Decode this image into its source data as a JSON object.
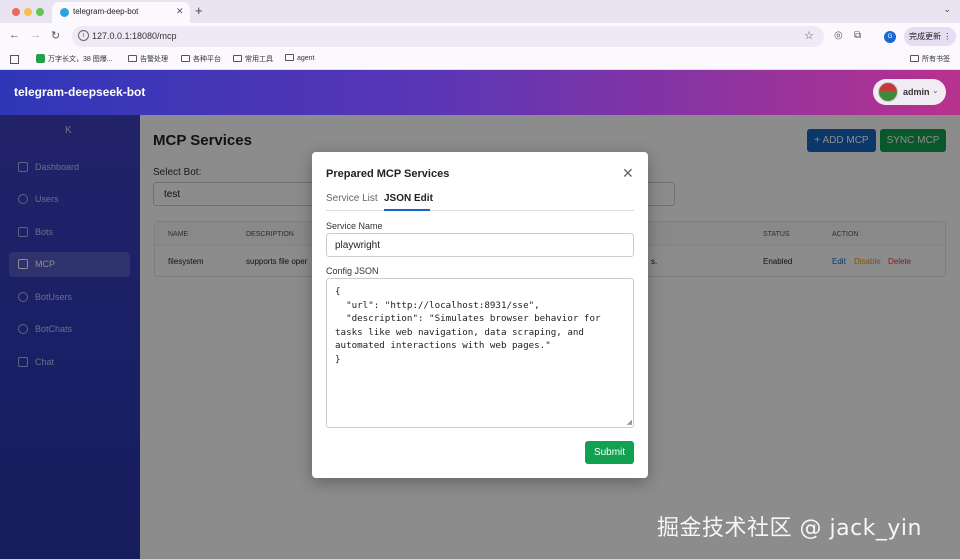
{
  "browser": {
    "tab_title": "telegram-deep-bot",
    "url": "127.0.0.1:18080/mcp",
    "profile_initial": "G",
    "update_label": "完成更新",
    "bookmarks": [
      "万字长文，38 图爆...",
      "告警处理",
      "各种平台",
      "常用工具",
      "agent"
    ],
    "all_bookmarks_label": "所有书签"
  },
  "app": {
    "title": "telegram-deepseek-bot",
    "user": "admin"
  },
  "sidebar": {
    "collapse_icon": "K",
    "items": [
      {
        "label": "Dashboard",
        "icon": "dashboard-icon",
        "active": false
      },
      {
        "label": "Users",
        "icon": "users-icon",
        "active": false
      },
      {
        "label": "Bots",
        "icon": "bot-icon",
        "active": false
      },
      {
        "label": "MCP",
        "icon": "database-icon",
        "active": true
      },
      {
        "label": "BotUsers",
        "icon": "bot-users-icon",
        "active": false
      },
      {
        "label": "BotChats",
        "icon": "chat-bubble-icon",
        "active": false
      },
      {
        "label": "Chat",
        "icon": "message-icon",
        "active": false
      }
    ]
  },
  "main": {
    "title": "MCP Services",
    "add_label": "+ ADD MCP",
    "sync_label": "SYNC MCP",
    "select_label": "Select Bot:",
    "select_value": "test",
    "table": {
      "columns": [
        "NAME",
        "DESCRIPTION",
        "STATUS",
        "ACTION"
      ],
      "rows": [
        {
          "name": "filesystem",
          "description": "supports file oper",
          "description_tail": "s.",
          "status": "Enabled",
          "actions": [
            "Edit",
            "Disable",
            "Delete"
          ]
        }
      ]
    }
  },
  "modal": {
    "title": "Prepared MCP Services",
    "tabs": [
      "Service List",
      "JSON Edit"
    ],
    "active_tab": "JSON Edit",
    "service_name_label": "Service Name",
    "service_name_value": "playwright",
    "config_label": "Config JSON",
    "config_value": "{\n  \"url\": \"http://localhost:8931/sse\",\n  \"description\": \"Simulates browser behavior for tasks like web navigation, data scraping, and automated interactions with web pages.\"\n}",
    "submit_label": "Submit"
  },
  "watermark": "掘金技术社区 @ jack_yin",
  "colors": {
    "primary": "#1565c0",
    "success": "#12a150",
    "warning": "#e69500",
    "danger": "#e53935",
    "header_start": "#2f37b7",
    "header_end": "#b8328e"
  }
}
